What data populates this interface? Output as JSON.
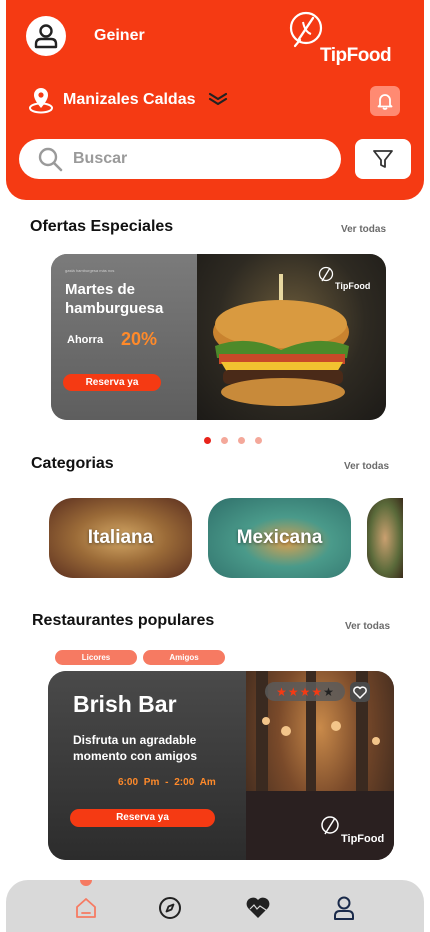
{
  "header": {
    "username": "Geiner",
    "brand": "TipFood",
    "location": "Manizales Caldas",
    "search_placeholder": "Buscar"
  },
  "offers": {
    "title": "Ofertas Especiales",
    "see_all": "Ver todas",
    "card": {
      "tiny_text": "gastá hamburgesa más nos",
      "title": "Martes de hamburguesa",
      "save_label": "Ahorra",
      "discount": "20%",
      "button": "Reserva ya",
      "brand": "TipFood"
    },
    "carousel": {
      "count": 4,
      "active": 0
    }
  },
  "categories": {
    "title": "Categorias",
    "see_all": "Ver todas",
    "items": [
      "Italiana",
      "Mexicana",
      ""
    ]
  },
  "popular": {
    "title": "Restaurantes populares",
    "see_all": "Ver todas",
    "tags": [
      "Licores",
      "Amigos"
    ],
    "card": {
      "name": "Brish Bar",
      "description": "Disfruta un agradable momento con amigos",
      "hours": "6:00 Pm  -  2:00 Am",
      "button": "Reserva ya",
      "rating": 4,
      "rating_max": 5,
      "brand": "TipFood"
    }
  },
  "nav": {
    "items": [
      "home-icon",
      "compass-icon",
      "heart-icon",
      "user-icon"
    ],
    "active": 0
  },
  "colors": {
    "brand": "#f53a13",
    "accent": "#ff8a2a",
    "tag": "#f67a62"
  }
}
